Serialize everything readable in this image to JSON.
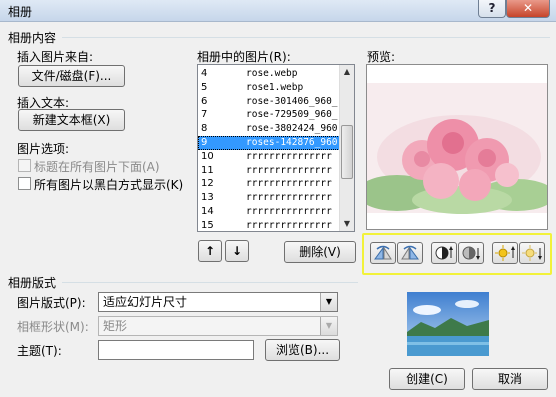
{
  "window": {
    "title": "相册",
    "help_label": "?",
    "close_label": "✕"
  },
  "album_content": {
    "section_title": "相册内容",
    "insert_picture_label": "插入图片来自:",
    "file_disk_button": "文件/磁盘(F)...",
    "insert_text_label": "插入文本:",
    "new_textbox_button": "新建文本框(X)",
    "picture_options_label": "图片选项:",
    "caption_below_label": "标题在所有图片下面(A)",
    "caption_below_checked": false,
    "black_white_label": "所有图片以黑白方式显示(K)",
    "black_white_checked": false
  },
  "picture_list": {
    "label": "相册中的图片(R):",
    "items": [
      {
        "num": "4",
        "name": "rose.webp"
      },
      {
        "num": "5",
        "name": "rose1.webp"
      },
      {
        "num": "6",
        "name": "rose-301406_960_"
      },
      {
        "num": "7",
        "name": "rose-729509_960_"
      },
      {
        "num": "8",
        "name": "rose-3802424_960"
      },
      {
        "num": "9",
        "name": "roses-142876_960"
      },
      {
        "num": "10",
        "name": "rrrrrrrrrrrrrrr"
      },
      {
        "num": "11",
        "name": "rrrrrrrrrrrrrrr"
      },
      {
        "num": "12",
        "name": "rrrrrrrrrrrrrrr"
      },
      {
        "num": "13",
        "name": "rrrrrrrrrrrrrrr"
      },
      {
        "num": "14",
        "name": "rrrrrrrrrrrrrrr"
      },
      {
        "num": "15",
        "name": "rrrrrrrrrrrrrrr"
      }
    ],
    "selected_index": 5,
    "move_up_label": "↑",
    "move_down_label": "↓",
    "delete_button": "删除(V)"
  },
  "preview": {
    "label": "预览:"
  },
  "album_layout": {
    "section_title": "相册版式",
    "picture_layout_label": "图片版式(P):",
    "picture_layout_value": "适应幻灯片尺寸",
    "frame_shape_label": "相框形状(M):",
    "frame_shape_value": "矩形",
    "theme_label": "主题(T):",
    "theme_value": "",
    "browse_button": "浏览(B)..."
  },
  "actions": {
    "create_button": "创建(C)",
    "cancel_button": "取消"
  }
}
